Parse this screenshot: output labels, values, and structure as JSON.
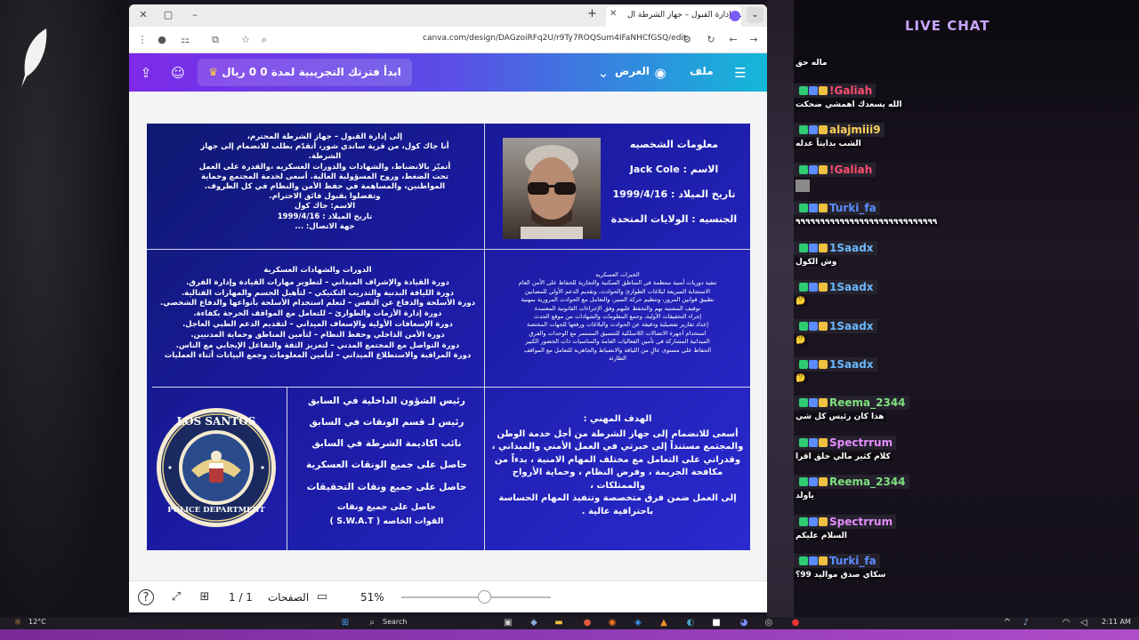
{
  "browser": {
    "tab_title": "إلى إدارة القبول – جهاز الشرطة ال...",
    "url": "canva.com/design/DAGzoiRFq2U/r9Ty7ROQSum4IFaNHCfGSQ/edit"
  },
  "canva": {
    "trial_label": "ابدأ فترتك التجريبية لمدة 0 0 ريال سعودي",
    "view_label": "العرض",
    "file_label": "ملف"
  },
  "document": {
    "letter_lines": [
      "إلى إدارة القبول – جهاز الشرطة المحترم،",
      "أنا جاك كول، من قرية ساندي شور، أتقدّم بطلب للانضمام إلى جهاز",
      "الشرطة.",
      "أتميّز بالانضباط، والشهادات والدورات العسكريه ،والقدرة على العمل",
      "تحت الضغط، وروح المسؤولية العالية. أسعى لخدمة المجتمع وحماية",
      "المواطنين، والمساهمة في حفظ الأمن والنظام في كل الظروف.",
      "وتفضلوا بقبول فائق الاحترام.",
      "الاسم: جاك كول",
      "تاريخ الميلاد : 1999/4/16",
      "جهة الاتصال: ..."
    ],
    "info_title": "معلومات الشخصيه",
    "info_name": "الاسم : Jack Cole",
    "info_dob": "تاريخ الميلاد : 1999/4/16",
    "info_nationality": "الجنسيه : الولايات المتحدة",
    "courses_title": "الدورات والشهادات العسكرية",
    "courses_lines": [
      "دورة القيادة والإشراف الميداني – لتطوير مهارات القيادة وإدارة الفرق.",
      "دورة اللياقة البدنية والتدريب التكتيكي – لتأهيل الجسم والمهارات القتالية.",
      "دورة الأسلحة والدفاع عن النفس – لتعلم استخدام الأسلحة بأنواعها والدفاع الشخصي.",
      "دورة إدارة الأزمات والطوارئ – للتعامل مع المواقف الحرجة بكفاءة.",
      "دورة الإسعافات الأولية والإسعاف الميداني – لتقديم الدعم الطبي العاجل.",
      "دورة الأمن الداخلي وحفظ النظام – لتأمين المناطق وحماية المدنيين.",
      "دورة التواصل مع المجتمع المدني – لتعزيز الثقة والتفاعل الإيجابي مع الناس.",
      "دورة المراقبة والاستطلاع الميداني – لتأمين المعلومات وجمع البيانات أثناء العمليات"
    ],
    "experience_title": "الخبرات العسكريه",
    "experience_lines": [
      "تنفيذ دوريات أمنية منتظمة في المناطق السكنية والتجارية للحفاظ على الأمن العام",
      "الاستجابة السريعة لبلاغات الطوارئ والحوادث، وتقديم الدعم الأولي للمصابين",
      "تطبيق قوانين المرور، وتنظيم حركة السير، والتعامل مع الحوادث المرورية بمهنية",
      "توقيف المشتبه بهم والتحفظ عليهم وفق الإجراءات القانونية المعتمدة",
      "إجراء التحقيقات الأولية، وجمع المعلومات والشهادات من موقع الحدث",
      "إعداد تقارير تفصيلية ودقيقة عن الحوادث والبلاغات ورفعها للجهات المختصة",
      "استخدام أجهزة الاتصالات اللاسلكية للتنسيق المستمر مع الوحدات والفرق",
      "الميدانية المشاركة في تأمين الفعاليات العامة والمناسبات ذات الحضور الكبير",
      "الحفاظ على مستوى عالٍ من اللياقة والانضباط والجاهزية للتعامل مع المواقف",
      "الطارئة"
    ],
    "positions": [
      "رئيس الشؤون الداخلية في السابق",
      "رئيس لـ قسم الونقات في السابق",
      "نائب اكاديمة الشرطة في السابق",
      "حاصل على جميع الونقات العسكرية",
      "حاصل على جميع ونقات التحقيقات",
      "حاصل على جميع ونقات",
      "القوات الخاصه ( S.W.A.T )"
    ],
    "goal_title": "الهدف المهني :",
    "goal_lines": [
      "أسعى للانضمام إلى جهاز الشرطة من أجل خدمة الوطن",
      "والمجتمع مستنداً إلى خبرتي في العمل الأمني والميداني ،",
      "وقدراتي على التعامل مع مختلف المهام الامنية ، بدءاً من",
      "مكافحة الجريمة ، وفرض النظام ، وحماية الأرواح والممتلكات ،",
      "إلى العمل ضمن فرق متخصصة وتنفيذ المهام الحساسة",
      "باحترافية عالية ."
    ],
    "seal_top": "LOS SANTOS",
    "seal_bottom": "POLICE DEPARTMENT"
  },
  "bottombar": {
    "page_count": "1 / 1",
    "pages_label": "الصفحات",
    "zoom": "51%",
    "zoom_slider_fraction": 0.51
  },
  "chat": {
    "title": "LIVE CHAT",
    "messages": [
      {
        "user": "",
        "text": "ماله حق",
        "color": "#ffffff"
      },
      {
        "user": "!Galiah",
        "text": "الله يسعدك اهمشي ضحكت",
        "color": "#ff4d6d"
      },
      {
        "user": "alajmiii9",
        "text": "الشب بدايتاً عدله",
        "color": "#ffd15c"
      },
      {
        "user": "!Galiah",
        "text": "",
        "color": "#ff4d6d"
      },
      {
        "user": "Turki_fa",
        "text": "٩٩٩٩٩٩٩٩٩٩٩٩٩٩٩٩٩٩٩٩٩٩٩٩٩٩٩٩٩",
        "color": "#5b8cff"
      },
      {
        "user": "1Saadx",
        "text": "وش الكول",
        "color": "#6ab8ff"
      },
      {
        "user": "1Saadx",
        "text": "🤔",
        "color": "#6ab8ff"
      },
      {
        "user": "1Saadx",
        "text": "🤔",
        "color": "#6ab8ff"
      },
      {
        "user": "1Saadx",
        "text": "🤔",
        "color": "#6ab8ff"
      },
      {
        "user": "Reema_2344",
        "text": "هذا كان رئيس كل شي",
        "color": "#7fe07f"
      },
      {
        "user": "Spectrrum",
        "text": "كلام كثير مالي خلق اقرا",
        "color": "#e58cff"
      },
      {
        "user": "Reema_2344",
        "text": "ياولد",
        "color": "#7fe07f"
      },
      {
        "user": "Spectrrum",
        "text": "السلام عليكم",
        "color": "#e58cff"
      },
      {
        "user": "Turki_fa",
        "text": "سكاي صدق مواليد 99؟",
        "color": "#5b8cff"
      }
    ]
  },
  "taskbar": {
    "weather_temp": "12°C",
    "search_label": "Search",
    "time": "2:11 AM",
    "date": "1/1/2026"
  }
}
